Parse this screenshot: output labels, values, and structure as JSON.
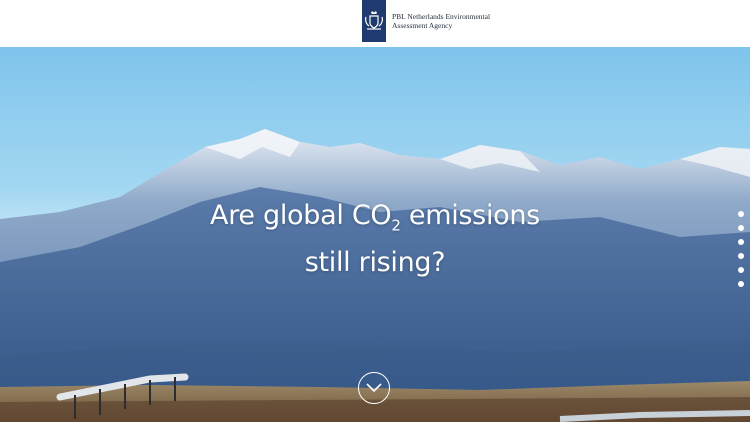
{
  "header": {
    "agency_line1": "PBL Netherlands Environmental",
    "agency_line2": "Assessment Agency",
    "emblem_icon": "royal-coat-of-arms-icon",
    "emblem_color": "#1f3a6e"
  },
  "hero": {
    "headline_part1": "Are global CO",
    "headline_sub": "2",
    "headline_part2": " emissions",
    "headline_line2": "still rising?",
    "scroll_icon": "chevron-down-icon"
  },
  "page_nav": {
    "dot_count": 6,
    "dot_color": "#ffffff"
  }
}
